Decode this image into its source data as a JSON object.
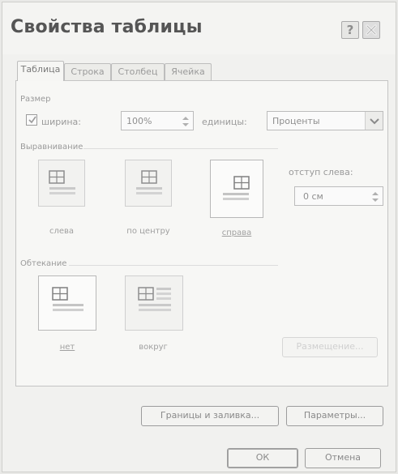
{
  "dialog": {
    "title": "Свойства таблицы",
    "help_label": "?"
  },
  "tabs": [
    {
      "label": "Таблица"
    },
    {
      "label": "Строка"
    },
    {
      "label": "Столбец"
    },
    {
      "label": "Ячейка"
    }
  ],
  "size": {
    "group_label": "Размер",
    "width_label": "ширина:",
    "width_checked": true,
    "width_value": "100%",
    "units_label": "единицы:",
    "units_value": "Проценты"
  },
  "alignment": {
    "group_label": "Выравнивание",
    "options": [
      {
        "label": "слева"
      },
      {
        "label": "по центру"
      },
      {
        "label": "справа"
      }
    ],
    "selected": "справа",
    "indent_label": "отступ слева:",
    "indent_value": "0 см"
  },
  "wrapping": {
    "group_label": "Обтекание",
    "options": [
      {
        "label": "нет"
      },
      {
        "label": "вокруг"
      }
    ],
    "selected": "нет",
    "placement_button": "Размещение..."
  },
  "buttons": {
    "borders": "Границы и заливка...",
    "options": "Параметры...",
    "ok": "ОК",
    "cancel": "Отмена"
  }
}
